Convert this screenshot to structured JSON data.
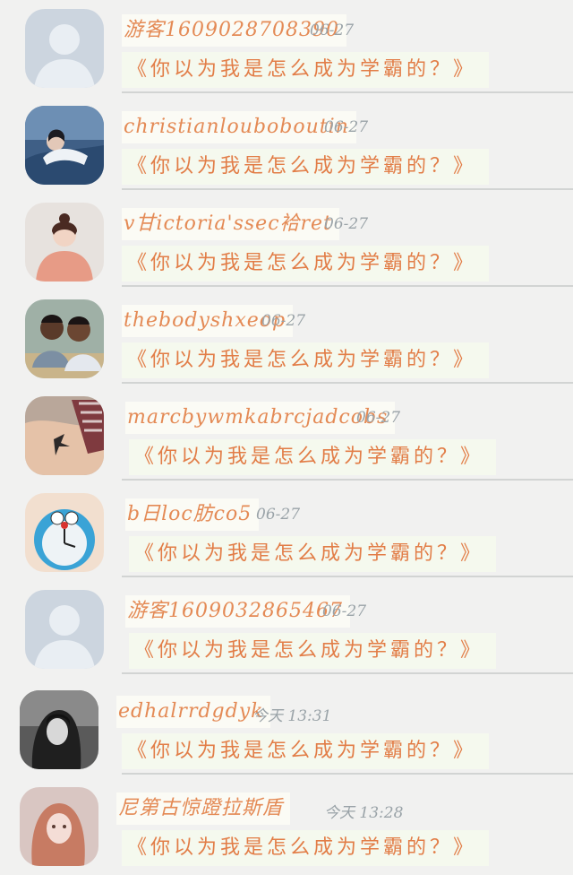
{
  "messages": [
    {
      "name": "游客1609028708390",
      "time": "06-27",
      "text": "《你以为我是怎么成为学霸的？》",
      "avatar_icon": "default-user-icon"
    },
    {
      "name": "christianlouboboutin",
      "time": "06-27",
      "text": "《你以为我是怎么成为学霸的？》",
      "avatar_icon": "photo-girl-blue"
    },
    {
      "name": "v甘ictoria'ssec袷ret",
      "time": "06-27",
      "text": "《你以为我是怎么成为学霸的？》",
      "avatar_icon": "photo-girl-peach"
    },
    {
      "name": "thebodyshxeop",
      "time": "06-27",
      "text": "《你以为我是怎么成为学霸的？》",
      "avatar_icon": "photo-two-boys"
    },
    {
      "name": "marcbywmkabrcjadcobs",
      "time": "06-27",
      "text": "《你以为我是怎么成为学霸的？》",
      "avatar_icon": "photo-bird-tattoo"
    },
    {
      "name": "b日loc肪co5",
      "time": "06-27",
      "text": "《你以为我是怎么成为学霸的？》",
      "avatar_icon": "photo-doraemon-clock"
    },
    {
      "name": "游客1609032865467",
      "time": "06-27",
      "text": "《你以为我是怎么成为学霸的？》",
      "avatar_icon": "default-user-icon"
    },
    {
      "name": "edhalrrdgdyk",
      "time": "今天 13:31",
      "text": "《你以为我是怎么成为学霸的？》",
      "avatar_icon": "photo-girl-bw"
    },
    {
      "name": "尼第古惊蹬拉斯盾",
      "time": "今天 13:28",
      "text": "《你以为我是怎么成为学霸的？》",
      "avatar_icon": "photo-girl-pink"
    }
  ],
  "colors": {
    "background": "#f1f1f0",
    "name_text": "#e48a55",
    "message_text": "#e27d47",
    "time_text": "#9aa3a8",
    "default_avatar": "#c9d3dd"
  }
}
